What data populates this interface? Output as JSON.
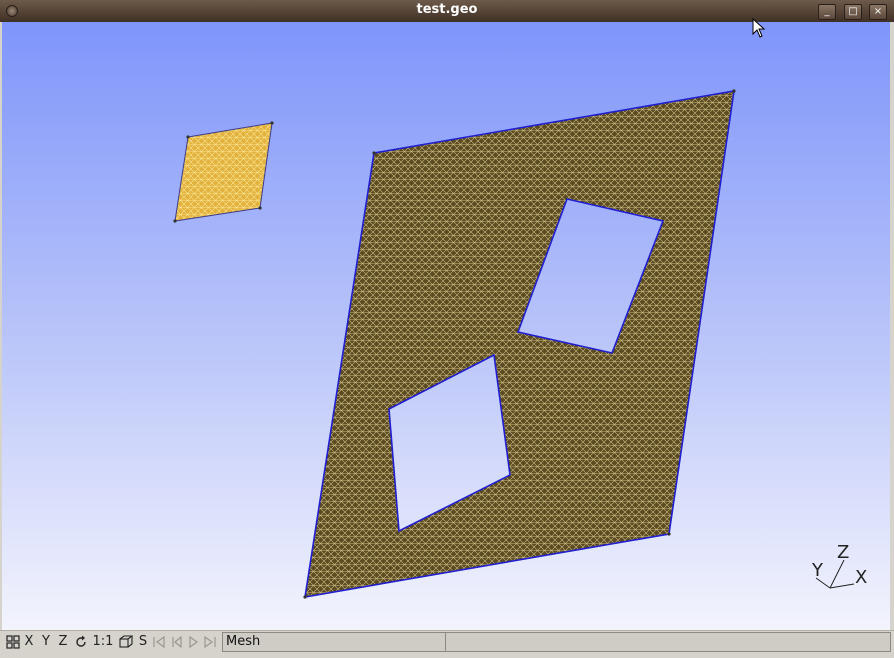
{
  "window": {
    "title": "test.geo",
    "minimize_glyph": "_",
    "maximize_glyph": "□",
    "close_glyph": "×"
  },
  "axes": {
    "y_label": "Y",
    "z_label": "Z",
    "x_label": "X"
  },
  "statusbar": {
    "x_button": "X",
    "y_button": "Y",
    "z_button": "Z",
    "scale_button": "1:1",
    "s_button": "S",
    "message": "Mesh",
    "message2": ""
  },
  "icons": {
    "view_menu": "grid-icon",
    "rotate": "rotate-icon",
    "projection": "cube-icon",
    "first": "first-frame-icon",
    "prev": "prev-frame-icon",
    "play": "play-icon",
    "last": "last-frame-icon"
  },
  "colors": {
    "mesh_large": "#6d5a2b",
    "mesh_small": "#e7b94a",
    "boundary": "#1f1fd0",
    "bg_top": "#7f95fb",
    "bg_bottom": "#f3f4fd"
  }
}
